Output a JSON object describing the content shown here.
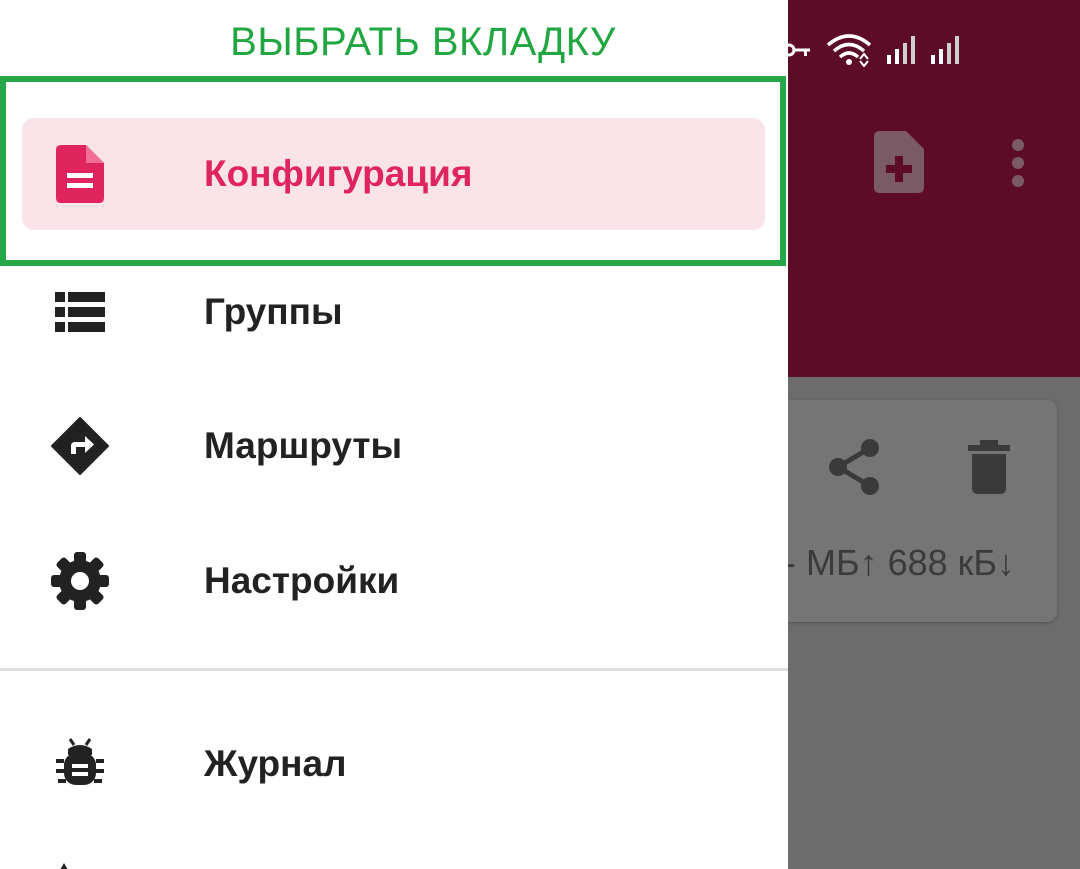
{
  "annotation": "ВЫБРАТЬ ВКЛАДКУ",
  "drawer": {
    "items": [
      {
        "label": "Конфигурация",
        "icon": "document-icon",
        "active": true
      },
      {
        "label": "Группы",
        "icon": "list-icon",
        "active": false
      },
      {
        "label": "Маршруты",
        "icon": "directions-icon",
        "active": false
      },
      {
        "label": "Настройки",
        "icon": "gear-icon",
        "active": false
      },
      {
        "label": "Журнал",
        "icon": "bug-icon",
        "active": false
      }
    ]
  },
  "background": {
    "toolbar_icons": [
      "add-document-icon",
      "more-vert-icon"
    ],
    "card_icons": [
      "share-icon",
      "trash-icon"
    ],
    "traffic": "- МБ↑ 688 кБ↓",
    "status_icons": [
      "key-icon",
      "wifi-icon",
      "signal-icon",
      "signal-icon"
    ]
  },
  "colors": {
    "accent": "#e0245e",
    "active_bg": "#fbe3ea",
    "annotation": "#22a642",
    "appbar": "#5c0c26",
    "scrim": "#6b6b6b"
  }
}
